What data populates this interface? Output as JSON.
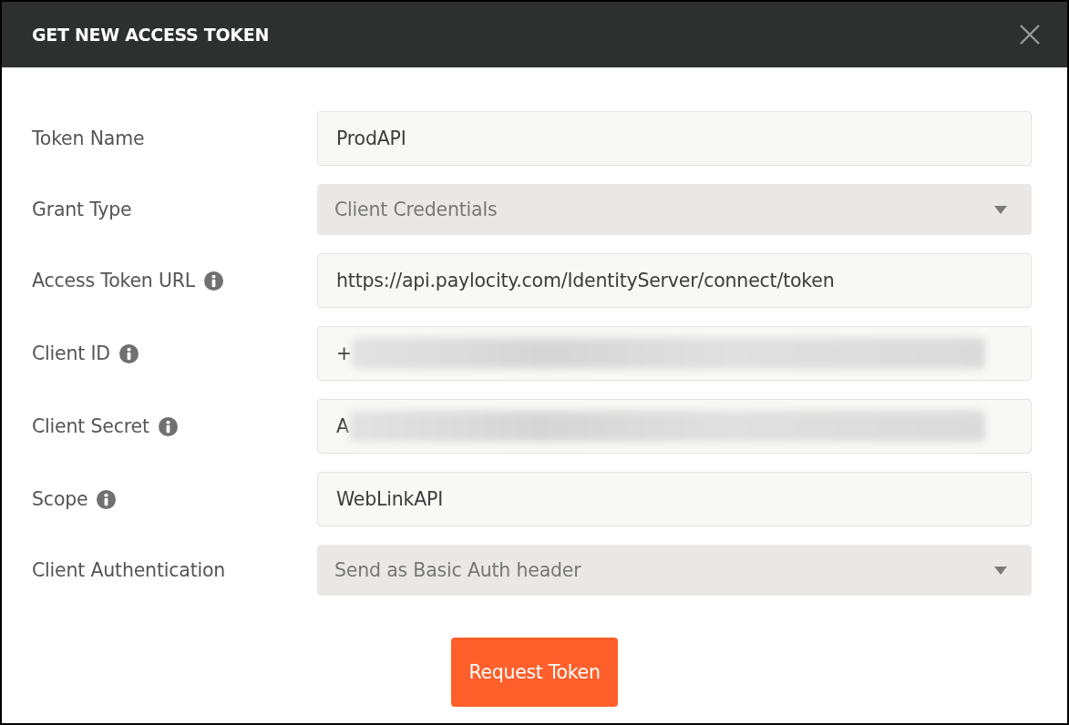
{
  "dialog": {
    "title": "GET NEW ACCESS TOKEN"
  },
  "fields": [
    {
      "kind": "text",
      "label": "Token Name",
      "info": false,
      "value": "ProdAPI",
      "redacted": false
    },
    {
      "kind": "select",
      "label": "Grant Type",
      "info": false,
      "value": "Client Credentials",
      "redacted": false
    },
    {
      "kind": "text",
      "label": "Access Token URL",
      "info": true,
      "value": "https://api.paylocity.com/IdentityServer/connect/token",
      "redacted": false
    },
    {
      "kind": "text",
      "label": "Client ID",
      "info": true,
      "value": "+",
      "redacted": true
    },
    {
      "kind": "text",
      "label": "Client Secret",
      "info": true,
      "value": "A",
      "redacted": true
    },
    {
      "kind": "text",
      "label": "Scope",
      "info": true,
      "value": "WebLinkAPI",
      "redacted": false
    },
    {
      "kind": "select",
      "label": "Client Authentication",
      "info": false,
      "value": "Send as Basic Auth header",
      "redacted": false
    }
  ],
  "buttons": [
    {
      "label": "Request Token"
    }
  ]
}
